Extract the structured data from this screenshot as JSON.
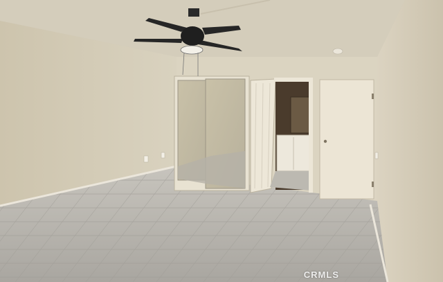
{
  "photo": {
    "watermark": "CRMLS"
  },
  "colors": {
    "ceiling": "#d6cfbd",
    "left_wall": "#d2cab4",
    "back_wall": "#dcd5c2",
    "right_wall": "#d8cfbb",
    "floor": "#b8b5ae",
    "door": "#ebe4d4",
    "fan_dark": "#2a2a2a"
  }
}
